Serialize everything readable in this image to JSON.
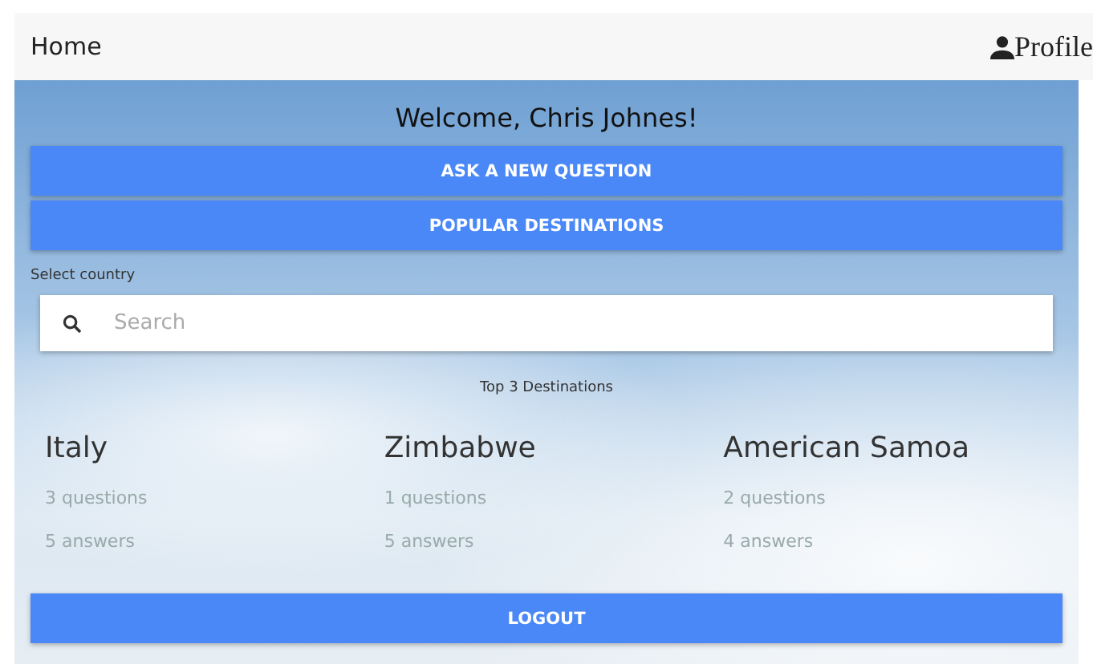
{
  "header": {
    "home": "Home",
    "profile": "Profile"
  },
  "welcome": "Welcome, Chris Johnes!",
  "buttons": [
    {
      "label": "ASK A NEW QUESTION"
    },
    {
      "label": "POPULAR DESTINATIONS"
    }
  ],
  "search": {
    "label": "Select country",
    "placeholder": "Search"
  },
  "top_title": "Top 3 Destinations",
  "destinations": [
    {
      "name": "Italy",
      "questions": "3 questions",
      "answers": "5 answers"
    },
    {
      "name": "Zimbabwe",
      "questions": "1 questions",
      "answers": "5 answers"
    },
    {
      "name": "American Samoa",
      "questions": "2 questions",
      "answers": "4 answers"
    }
  ],
  "logout": "LOGOUT"
}
